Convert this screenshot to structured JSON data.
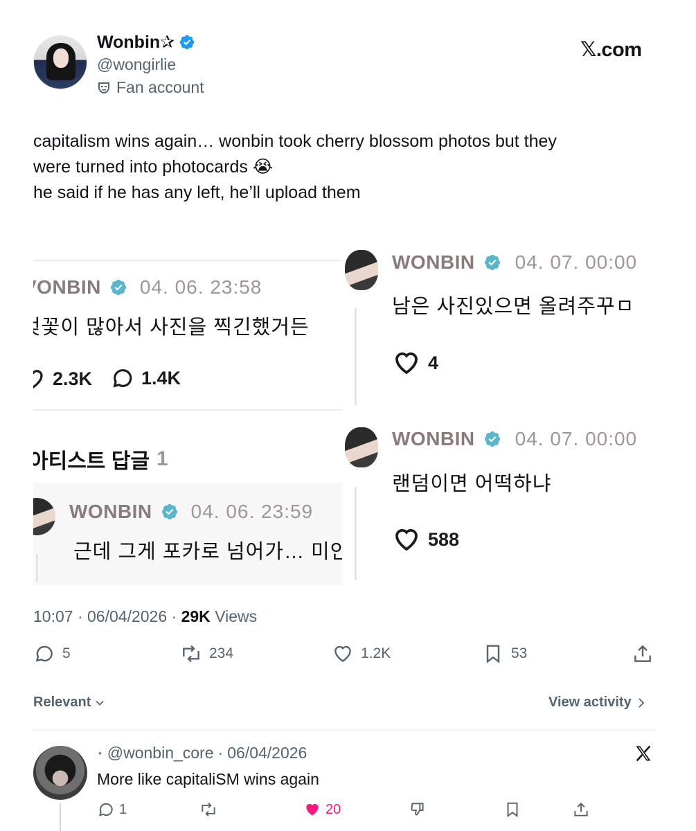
{
  "author": {
    "name": "Wonbin✰",
    "handle": "@wongirlie",
    "label": "Fan account"
  },
  "site_label": "𝕏.com",
  "tweet": {
    "lines": [
      "capitalism wins again… wonbin took cherry blossom photos but they",
      "were turned into photocards 😭",
      "he said if he has any left, he’ll upload them"
    ]
  },
  "embed": {
    "left": {
      "post": {
        "name": "VONBIN",
        "date": "04. 06. 23:58",
        "text": "벚꽃이 많아서 사진을 찍긴했거든",
        "likes": "2.3K",
        "comments": "1.4K"
      },
      "artist_replies_label": "아티스트 답글",
      "artist_replies_count": "1",
      "reply": {
        "name": "WONBIN",
        "date": "04. 06. 23:59",
        "text": "근데 그게 포카로 넘어가… 미안"
      }
    },
    "right": [
      {
        "name": "WONBIN",
        "date": "04. 07. 00:00",
        "text": "남은 사진있으면 올려주꾸ㅁ",
        "likes": "4"
      },
      {
        "name": "WONBIN",
        "date": "04. 07. 00:00",
        "text": "랜덤이면 어떡하냐",
        "likes": "588"
      }
    ]
  },
  "meta": {
    "time": "10:07",
    "date": "06/04/2026",
    "views_count": "29K",
    "views_label": "Views"
  },
  "actions": {
    "replies": "5",
    "reposts": "234",
    "likes": "1.2K",
    "bookmarks": "53"
  },
  "sort": {
    "relevant_label": "Relevant",
    "view_activity_label": "View activity"
  },
  "reply": {
    "handle": "@wonbin_core",
    "date": "06/04/2026",
    "text": "More like capitaliSM wins again",
    "replies": "1",
    "likes": "20"
  },
  "colors": {
    "verified": "#1d9bf0",
    "liked": "#f91880",
    "muted": "#536471",
    "embed_verified": "#59b7c9"
  }
}
